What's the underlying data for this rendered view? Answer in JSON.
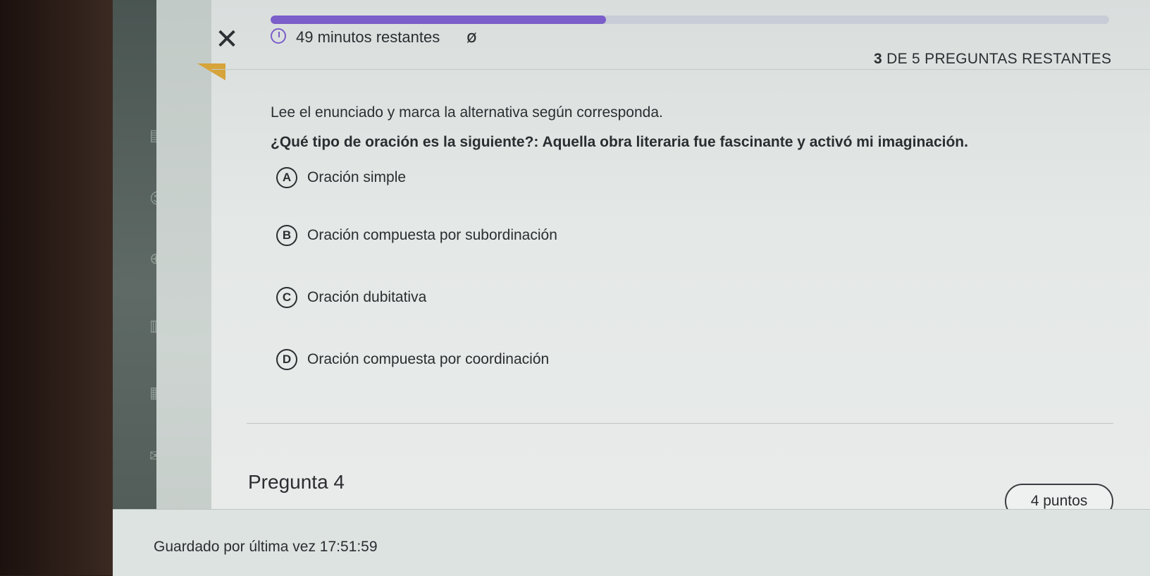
{
  "header": {
    "close_icon": "close-icon",
    "timer_icon": "clock-icon",
    "timer_text": "49 minutos restantes",
    "eye_icon": "eye-slash-icon",
    "remaining_count": "3",
    "remaining_text": "DE 5 PREGUNTAS RESTANTES",
    "progress_fraction": 0.4,
    "progress_color": "#7b5ec9"
  },
  "question": {
    "instruction": "Lee el enunciado y marca la alternativa según corresponda.",
    "text": "¿Qué tipo de oración es la siguiente?: Aquella obra literaria fue fascinante y activó mi imaginación.",
    "options": [
      {
        "letter": "A",
        "label": "Oración simple"
      },
      {
        "letter": "B",
        "label": "Oración compuesta por subordinación"
      },
      {
        "letter": "C",
        "label": "Oración dubitativa"
      },
      {
        "letter": "D",
        "label": "Oración compuesta por coordinación"
      }
    ]
  },
  "next_question": {
    "title": "Pregunta 4",
    "points": "4 puntos"
  },
  "footer": {
    "saved_text": "Guardado por última vez 17:51:59"
  }
}
